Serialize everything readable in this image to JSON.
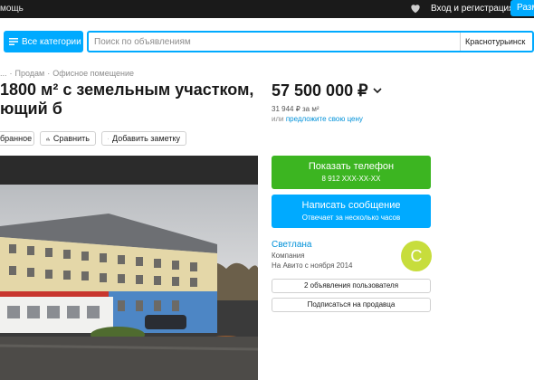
{
  "topbar": {
    "help_label": "мощь",
    "login_label": "Вход и регистрация",
    "post_label": "Разм"
  },
  "search": {
    "categories_label": "Все категории",
    "placeholder": "Поиск по объявлениям",
    "city": "Краснотурьинск"
  },
  "breadcrumb": {
    "items": [
      "...",
      "Продам",
      "Офисное помещение"
    ]
  },
  "listing": {
    "title": "1800 м² с земельным участком, ющий б",
    "price": "57 500 000 ₽",
    "price_per_sqm": "31 944 ₽ за м²",
    "price_suggest_prefix": "или ",
    "price_suggest_link": "предложите свою цену"
  },
  "actions": {
    "favorite_label": "бранное",
    "compare_label": "Сравнить",
    "note_label": "Добавить заметку"
  },
  "contact": {
    "phone_label": "Показать телефон",
    "phone_masked": "8 912 XXX-XX-XX",
    "message_label": "Написать сообщение",
    "message_sub": "Отвечает за несколько часов"
  },
  "seller": {
    "name": "Светлана",
    "type": "Компания",
    "since": "На Авито с ноября 2014",
    "avatar_letter": "C",
    "avatar_color": "#c7dd3c",
    "ads_label": "2 объявления пользователя",
    "subscribe_label": "Подписаться на продавца"
  },
  "colors": {
    "accent": "#00aaff",
    "phone_green": "#3cb521",
    "link": "#0091d9"
  }
}
